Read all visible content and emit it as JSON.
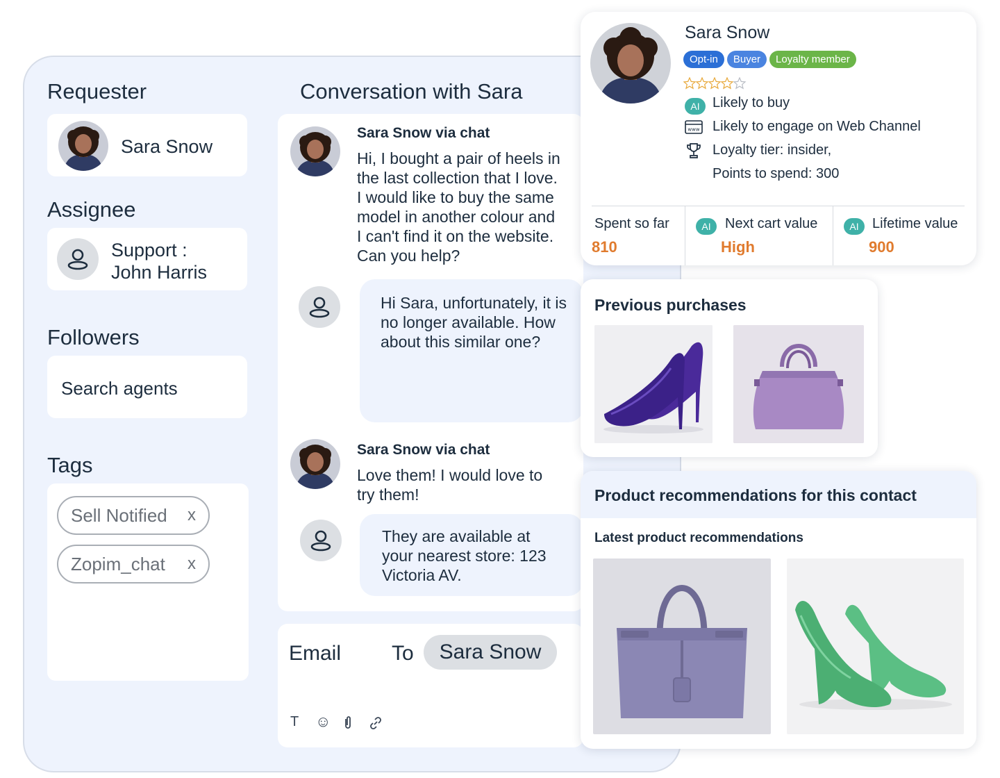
{
  "left_panel": {
    "requester": {
      "title": "Requester",
      "name": "Sara Snow"
    },
    "assignee": {
      "title": "Assignee",
      "name_line1": "Support :",
      "name_line2": "John Harris"
    },
    "followers": {
      "title": "Followers",
      "placeholder": "Search agents"
    },
    "tags": {
      "title": "Tags",
      "items": [
        {
          "label": "Sell Notified",
          "remove": "x"
        },
        {
          "label": "Zopim_chat",
          "remove": "x"
        }
      ]
    }
  },
  "conversation": {
    "title": "Conversation with Sara",
    "messages": [
      {
        "sender": "Sara Snow via chat",
        "lines": [
          "Hi, I bought a pair of heels in",
          "the last collection that I love.",
          "I would like to buy the same",
          "model in another colour and",
          "I can't find it on the website.",
          "Can you help?"
        ]
      },
      {
        "lines": [
          "Hi Sara, unfortunately, it is",
          "no longer available. How",
          "about this similar one?"
        ]
      },
      {
        "sender": "Sara Snow via chat",
        "lines": [
          "Love them! I would love to",
          "try them!"
        ]
      },
      {
        "lines": [
          "They are available at",
          "your nearest store: 123",
          "Victoria AV."
        ]
      }
    ],
    "composer": {
      "channel": "Email",
      "to_label": "To",
      "recipient": "Sara Snow",
      "tools": {
        "text": "T",
        "emoji": "☺"
      }
    }
  },
  "profile_card": {
    "name": "Sara Snow",
    "badges": [
      {
        "label": "Opt-in",
        "color": "#2b6fd6"
      },
      {
        "label": "Buyer",
        "color": "#4a84e0"
      },
      {
        "label": "Loyalty member",
        "color": "#6bb548"
      }
    ],
    "rating": {
      "value": 4,
      "max": 5
    },
    "insights": [
      {
        "icon": "ai",
        "label": "AI",
        "text": "Likely to buy"
      },
      {
        "icon": "www-icon",
        "text": "Likely to engage on Web Channel"
      },
      {
        "icon": "trophy-icon",
        "text": "Loyalty tier: insider,",
        "text2": "Points to spend: 300"
      }
    ],
    "stats": [
      {
        "label": "Spent so far",
        "value": "810"
      },
      {
        "ai": "AI",
        "label": "Next cart value",
        "value": "High"
      },
      {
        "ai": "AI",
        "label": "Lifetime value",
        "value": "900"
      }
    ]
  },
  "previous_purchases": {
    "title": "Previous purchases"
  },
  "recommendations": {
    "title": "Product recommendations for this contact",
    "subtitle": "Latest product recommendations"
  },
  "colors": {
    "accent_orange": "#e07b2e",
    "ai_teal": "#3fb1a8",
    "panel_bg": "#eef3fd",
    "star_gold": "#e8a93b"
  }
}
